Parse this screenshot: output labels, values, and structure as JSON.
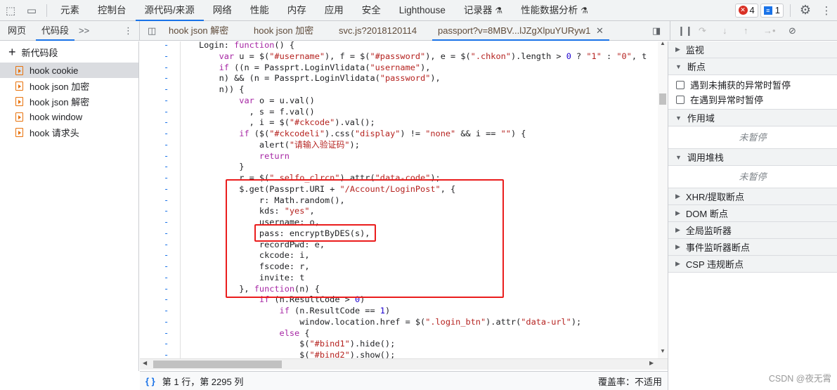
{
  "toolbar": {
    "inspect_icon": "inspect-element-icon",
    "device_icon": "device-toggle-icon",
    "tabs": [
      "元素",
      "控制台",
      "源代码/来源",
      "网络",
      "性能",
      "内存",
      "应用",
      "安全",
      "Lighthouse",
      "记录器",
      "性能数据分析"
    ],
    "active_tab": "源代码/来源",
    "errors": "4",
    "messages": "1"
  },
  "nav": {
    "tabs": [
      "网页",
      "代码段"
    ],
    "more": ">>",
    "active": "代码段"
  },
  "files": {
    "tabs": [
      "hook json 解密",
      "hook json 加密",
      "svc.js?2018120114",
      "passport?v=8MBV...lJZgXlpuYURyw1"
    ],
    "active": "passport?v=8MBV...lJZgXlpuYURyw1"
  },
  "snippets": {
    "new_label": "新代码段",
    "items": [
      "hook cookie",
      "hook json 加密",
      "hook json 解密",
      "hook window",
      "hook 请求头"
    ],
    "selected": "hook cookie"
  },
  "code": {
    "gutter_mark": "-",
    "lines": [
      "Login: function() {",
      "    var u = $(\"#username\"), f = $(\"#password\"), e = $(\".chkon\").length > 0 ? \"1\" : \"0\", t",
      "    if ((n = Passprt.LoginVlidata(\"username\"),",
      "    n) && (n = Passprt.LoginVlidata(\"password\"),",
      "    n)) {",
      "        var o = u.val()",
      "          , s = f.val()",
      "          , i = $(\"#ckcode\").val();",
      "        if ($(\"#ckcodeli\").css(\"display\") != \"none\" && i == \"\") {",
      "            alert(\"请输入验证码\");",
      "            return",
      "        }",
      "        r = $(\".selfo_clrcn\").attr(\"data-code\");",
      "        $.get(Passprt.URI + \"/Account/LoginPost\", {",
      "            r: Math.random(),",
      "            kds: \"yes\",",
      "            username: o,",
      "            pass: encryptByDES(s),",
      "            recordPwd: e,",
      "            ckcode: i,",
      "            fscode: r,",
      "            invite: t",
      "        }, function(n) {",
      "            if (n.ResultCode > 0)",
      "                if (n.ResultCode == 1)",
      "                    window.location.href = $(\".login_btn\").attr(\"data-url\");",
      "                else {",
      "                    $(\"#bind1\").hide();",
      "                    $(\"#bind2\").show();"
    ]
  },
  "status": {
    "position": "第 1 行，第 2295 列",
    "coverage": "覆盖率：不适用"
  },
  "debugger": {
    "watch": "监视",
    "breakpoints": "断点",
    "checkboxes": [
      "遇到未捕获的异常时暂停",
      "在遇到异常时暂停"
    ],
    "scope": "作用域",
    "not_paused": "未暂停",
    "callstack": "调用堆栈",
    "collapsed": [
      "XHR/提取断点",
      "DOM 断点",
      "全局监听器",
      "事件监听器断点",
      "CSP 违规断点"
    ]
  },
  "watermark": "CSDN @夜无霄",
  "colors": {
    "accent": "#1a73e8",
    "highlight_box": "#ea1d1d"
  }
}
